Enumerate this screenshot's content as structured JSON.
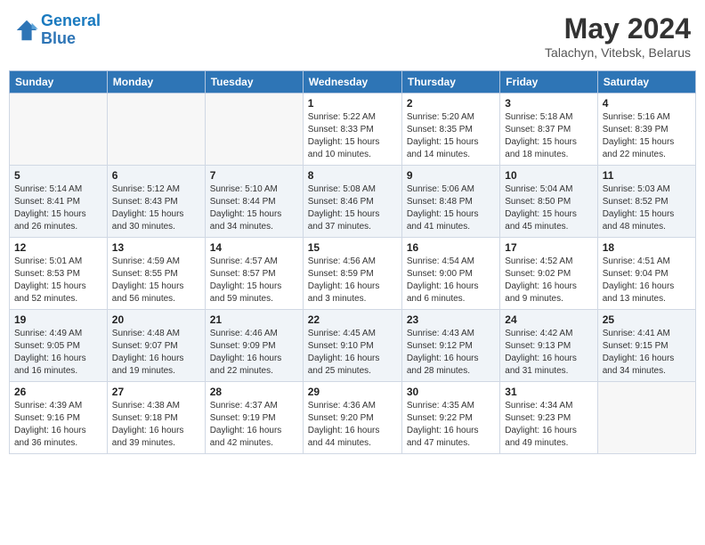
{
  "logo": {
    "text_general": "General",
    "text_blue": "Blue"
  },
  "title": "May 2024",
  "subtitle": "Talachyn, Vitebsk, Belarus",
  "days_of_week": [
    "Sunday",
    "Monday",
    "Tuesday",
    "Wednesday",
    "Thursday",
    "Friday",
    "Saturday"
  ],
  "weeks": [
    [
      {
        "day": "",
        "info": ""
      },
      {
        "day": "",
        "info": ""
      },
      {
        "day": "",
        "info": ""
      },
      {
        "day": "1",
        "info": "Sunrise: 5:22 AM\nSunset: 8:33 PM\nDaylight: 15 hours\nand 10 minutes."
      },
      {
        "day": "2",
        "info": "Sunrise: 5:20 AM\nSunset: 8:35 PM\nDaylight: 15 hours\nand 14 minutes."
      },
      {
        "day": "3",
        "info": "Sunrise: 5:18 AM\nSunset: 8:37 PM\nDaylight: 15 hours\nand 18 minutes."
      },
      {
        "day": "4",
        "info": "Sunrise: 5:16 AM\nSunset: 8:39 PM\nDaylight: 15 hours\nand 22 minutes."
      }
    ],
    [
      {
        "day": "5",
        "info": "Sunrise: 5:14 AM\nSunset: 8:41 PM\nDaylight: 15 hours\nand 26 minutes."
      },
      {
        "day": "6",
        "info": "Sunrise: 5:12 AM\nSunset: 8:43 PM\nDaylight: 15 hours\nand 30 minutes."
      },
      {
        "day": "7",
        "info": "Sunrise: 5:10 AM\nSunset: 8:44 PM\nDaylight: 15 hours\nand 34 minutes."
      },
      {
        "day": "8",
        "info": "Sunrise: 5:08 AM\nSunset: 8:46 PM\nDaylight: 15 hours\nand 37 minutes."
      },
      {
        "day": "9",
        "info": "Sunrise: 5:06 AM\nSunset: 8:48 PM\nDaylight: 15 hours\nand 41 minutes."
      },
      {
        "day": "10",
        "info": "Sunrise: 5:04 AM\nSunset: 8:50 PM\nDaylight: 15 hours\nand 45 minutes."
      },
      {
        "day": "11",
        "info": "Sunrise: 5:03 AM\nSunset: 8:52 PM\nDaylight: 15 hours\nand 48 minutes."
      }
    ],
    [
      {
        "day": "12",
        "info": "Sunrise: 5:01 AM\nSunset: 8:53 PM\nDaylight: 15 hours\nand 52 minutes."
      },
      {
        "day": "13",
        "info": "Sunrise: 4:59 AM\nSunset: 8:55 PM\nDaylight: 15 hours\nand 56 minutes."
      },
      {
        "day": "14",
        "info": "Sunrise: 4:57 AM\nSunset: 8:57 PM\nDaylight: 15 hours\nand 59 minutes."
      },
      {
        "day": "15",
        "info": "Sunrise: 4:56 AM\nSunset: 8:59 PM\nDaylight: 16 hours\nand 3 minutes."
      },
      {
        "day": "16",
        "info": "Sunrise: 4:54 AM\nSunset: 9:00 PM\nDaylight: 16 hours\nand 6 minutes."
      },
      {
        "day": "17",
        "info": "Sunrise: 4:52 AM\nSunset: 9:02 PM\nDaylight: 16 hours\nand 9 minutes."
      },
      {
        "day": "18",
        "info": "Sunrise: 4:51 AM\nSunset: 9:04 PM\nDaylight: 16 hours\nand 13 minutes."
      }
    ],
    [
      {
        "day": "19",
        "info": "Sunrise: 4:49 AM\nSunset: 9:05 PM\nDaylight: 16 hours\nand 16 minutes."
      },
      {
        "day": "20",
        "info": "Sunrise: 4:48 AM\nSunset: 9:07 PM\nDaylight: 16 hours\nand 19 minutes."
      },
      {
        "day": "21",
        "info": "Sunrise: 4:46 AM\nSunset: 9:09 PM\nDaylight: 16 hours\nand 22 minutes."
      },
      {
        "day": "22",
        "info": "Sunrise: 4:45 AM\nSunset: 9:10 PM\nDaylight: 16 hours\nand 25 minutes."
      },
      {
        "day": "23",
        "info": "Sunrise: 4:43 AM\nSunset: 9:12 PM\nDaylight: 16 hours\nand 28 minutes."
      },
      {
        "day": "24",
        "info": "Sunrise: 4:42 AM\nSunset: 9:13 PM\nDaylight: 16 hours\nand 31 minutes."
      },
      {
        "day": "25",
        "info": "Sunrise: 4:41 AM\nSunset: 9:15 PM\nDaylight: 16 hours\nand 34 minutes."
      }
    ],
    [
      {
        "day": "26",
        "info": "Sunrise: 4:39 AM\nSunset: 9:16 PM\nDaylight: 16 hours\nand 36 minutes."
      },
      {
        "day": "27",
        "info": "Sunrise: 4:38 AM\nSunset: 9:18 PM\nDaylight: 16 hours\nand 39 minutes."
      },
      {
        "day": "28",
        "info": "Sunrise: 4:37 AM\nSunset: 9:19 PM\nDaylight: 16 hours\nand 42 minutes."
      },
      {
        "day": "29",
        "info": "Sunrise: 4:36 AM\nSunset: 9:20 PM\nDaylight: 16 hours\nand 44 minutes."
      },
      {
        "day": "30",
        "info": "Sunrise: 4:35 AM\nSunset: 9:22 PM\nDaylight: 16 hours\nand 47 minutes."
      },
      {
        "day": "31",
        "info": "Sunrise: 4:34 AM\nSunset: 9:23 PM\nDaylight: 16 hours\nand 49 minutes."
      },
      {
        "day": "",
        "info": ""
      }
    ]
  ]
}
